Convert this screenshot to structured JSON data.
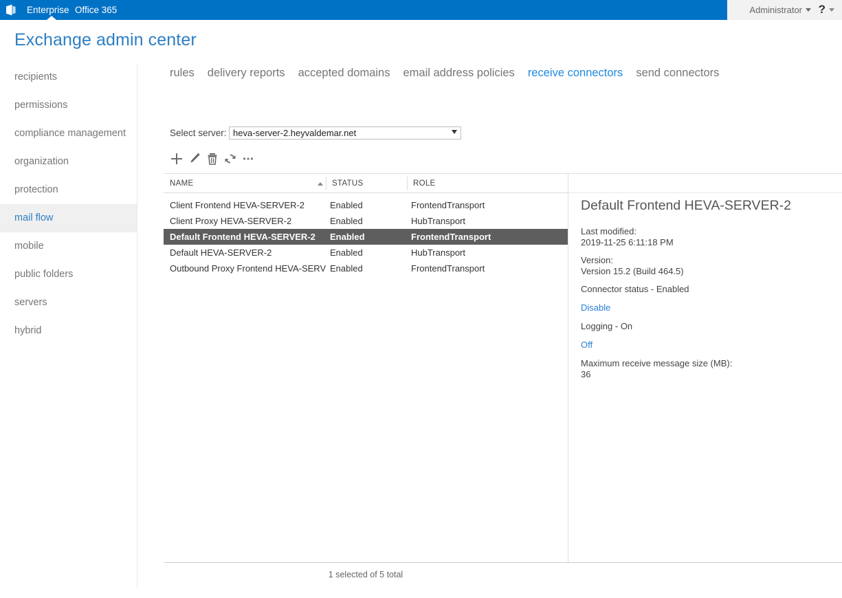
{
  "suite": {
    "logo_icon": "office-logo-icon",
    "enterprise_label": "Enterprise",
    "office365_label": "Office 365",
    "admin_label": "Administrator",
    "help_glyph": "?",
    "blue": "#0072c6"
  },
  "page": {
    "title": "Exchange admin center",
    "title_color": "#2e7fc4"
  },
  "sidebar": {
    "items": [
      {
        "label": "recipients",
        "selected": false
      },
      {
        "label": "permissions",
        "selected": false
      },
      {
        "label": "compliance management",
        "selected": false
      },
      {
        "label": "organization",
        "selected": false
      },
      {
        "label": "protection",
        "selected": false
      },
      {
        "label": "mail flow",
        "selected": true
      },
      {
        "label": "mobile",
        "selected": false
      },
      {
        "label": "public folders",
        "selected": false
      },
      {
        "label": "servers",
        "selected": false
      },
      {
        "label": "hybrid",
        "selected": false
      }
    ]
  },
  "tabs": [
    {
      "label": "rules",
      "active": false
    },
    {
      "label": "delivery reports",
      "active": false
    },
    {
      "label": "accepted domains",
      "active": false
    },
    {
      "label": "email address policies",
      "active": false
    },
    {
      "label": "receive connectors",
      "active": true
    },
    {
      "label": "send connectors",
      "active": false
    }
  ],
  "server_selector": {
    "label": "Select server:",
    "value": "heva-server-2.heyvaldemar.net",
    "options": [
      "heva-server-2.heyvaldemar.net"
    ]
  },
  "toolbar": {
    "buttons": [
      {
        "name": "add-icon",
        "title": "New"
      },
      {
        "name": "edit-pencil-icon",
        "title": "Edit"
      },
      {
        "name": "delete-trash-icon",
        "title": "Delete"
      },
      {
        "name": "refresh-icon",
        "title": "Refresh"
      },
      {
        "name": "more-ellipsis-icon",
        "title": "More options"
      }
    ]
  },
  "table": {
    "columns": [
      "NAME",
      "STATUS",
      "ROLE"
    ],
    "sort_column": "NAME",
    "sort_direction": "asc",
    "rows": [
      {
        "name": "Client Frontend HEVA-SERVER-2",
        "status": "Enabled",
        "role": "FrontendTransport",
        "selected": false
      },
      {
        "name": "Client Proxy HEVA-SERVER-2",
        "status": "Enabled",
        "role": "HubTransport",
        "selected": false
      },
      {
        "name": "Default Frontend HEVA-SERVER-2",
        "status": "Enabled",
        "role": "FrontendTransport",
        "selected": true
      },
      {
        "name": "Default HEVA-SERVER-2",
        "status": "Enabled",
        "role": "HubTransport",
        "selected": false
      },
      {
        "name": "Outbound Proxy Frontend HEVA-SERVE...",
        "status": "Enabled",
        "role": "FrontendTransport",
        "selected": false
      }
    ]
  },
  "details": {
    "title": "Default Frontend HEVA-SERVER-2",
    "last_modified_label": "Last modified:",
    "last_modified_value": "2019-11-25 6:11:18 PM",
    "version_label": "Version:",
    "version_value": "Version 15.2 (Build 464.5)",
    "connector_status": "Connector status - Enabled",
    "disable_link": "Disable",
    "logging_status": "Logging - On",
    "logging_off_link": "Off",
    "max_size_label": "Maximum receive message size (MB):",
    "max_size_value": "36"
  },
  "footer": {
    "status": "1 selected of 5 total"
  }
}
